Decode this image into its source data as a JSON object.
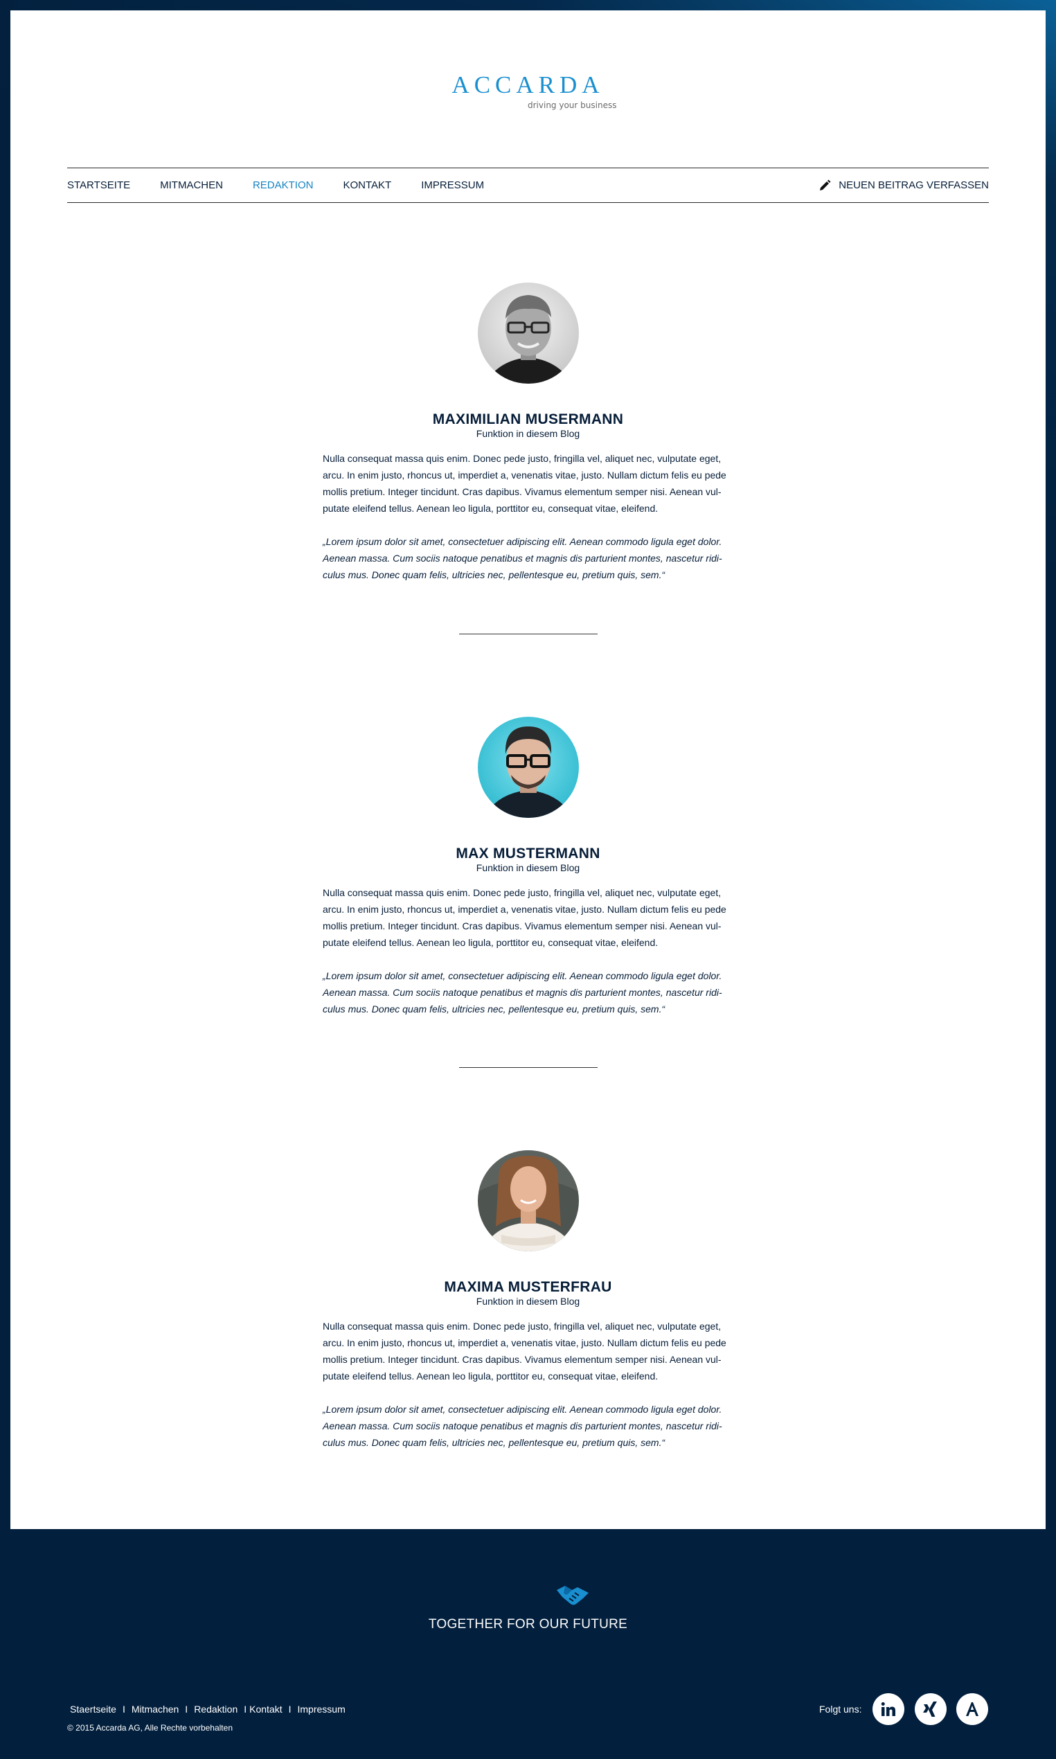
{
  "brand": {
    "logo_text": "ACCARDA",
    "tagline": "driving your business"
  },
  "nav": {
    "items": [
      {
        "label": "STARTSEITE",
        "active": false
      },
      {
        "label": "MITMACHEN",
        "active": false
      },
      {
        "label": "REDAKTION",
        "active": true
      },
      {
        "label": "KONTAKT",
        "active": false
      },
      {
        "label": "IMPRESSUM",
        "active": false
      }
    ],
    "compose_label": "NEUEN BEITRAG VERFASSEN",
    "compose_icon": "pencil-icon"
  },
  "profiles": [
    {
      "name": "MAXIMILIAN MUSERMANN",
      "role": "Funktion in diesem Blog",
      "bio": "Nulla consequat massa quis enim. Donec pede justo, fringilla vel, aliquet nec, vulputate eget, arcu. In enim justo, rhoncus ut, imperdiet a, venenatis vitae, justo. Nullam dictum felis eu pede mollis pretium. Integer tincidunt. Cras dapibus. Vivamus elementum semper nisi. Aenean vul-putate eleifend tellus. Aenean leo ligula, porttitor eu, consequat vitae, eleifend.",
      "quote": "„Lorem ipsum dolor sit amet, consectetuer adipiscing elit. Aenean commodo ligula eget dolor. Aenean massa. Cum sociis natoque penatibus et magnis dis parturient montes, nascetur ridi-culus mus. Donec quam felis, ultricies nec, pellentesque eu, pretium quis, sem.“"
    },
    {
      "name": "MAX MUSTERMANN",
      "role": "Funktion in diesem Blog",
      "bio": "Nulla consequat massa quis enim. Donec pede justo, fringilla vel, aliquet nec, vulputate eget, arcu. In enim justo, rhoncus ut, imperdiet a, venenatis vitae, justo. Nullam dictum felis eu pede mollis pretium. Integer tincidunt. Cras dapibus. Vivamus elementum semper nisi. Aenean vul-putate eleifend tellus. Aenean leo ligula, porttitor eu, consequat vitae, eleifend.",
      "quote": "„Lorem ipsum dolor sit amet, consectetuer adipiscing elit. Aenean commodo ligula eget dolor. Aenean massa. Cum sociis natoque penatibus et magnis dis parturient montes, nascetur ridi-culus mus. Donec quam felis, ultricies nec, pellentesque eu, pretium quis, sem.“"
    },
    {
      "name": "MAXIMA MUSTERFRAU",
      "role": "Funktion in diesem Blog",
      "bio": "Nulla consequat massa quis enim. Donec pede justo, fringilla vel, aliquet nec, vulputate eget, arcu. In enim justo, rhoncus ut, imperdiet a, venenatis vitae, justo. Nullam dictum felis eu pede mollis pretium. Integer tincidunt. Cras dapibus. Vivamus elementum semper nisi. Aenean vul-putate eleifend tellus. Aenean leo ligula, porttitor eu, consequat vitae, eleifend.",
      "quote": "„Lorem ipsum dolor sit amet, consectetuer adipiscing elit. Aenean commodo ligula eget dolor. Aenean massa. Cum sociis natoque penatibus et magnis dis parturient montes, nascetur ridi-culus mus. Donec quam felis, ultricies nec, pellentesque eu, pretium quis, sem.“"
    }
  ],
  "footer": {
    "icon": "handshake-icon",
    "slogan": "TOGETHER FOR OUR FUTURE",
    "links": [
      "Staertseite",
      "Mitmachen",
      "Redaktion",
      "Kontakt",
      "Impressum"
    ],
    "separator": "I",
    "copyright": "© 2015 Accarda AG, Alle Rechte vorbehalten",
    "follow_label": "Folgt uns:",
    "social": [
      "linkedin-icon",
      "xing-icon",
      "a-icon"
    ]
  },
  "colors": {
    "navy": "#021f3d",
    "accent": "#1584c0",
    "text": "#061d38",
    "white": "#ffffff"
  }
}
